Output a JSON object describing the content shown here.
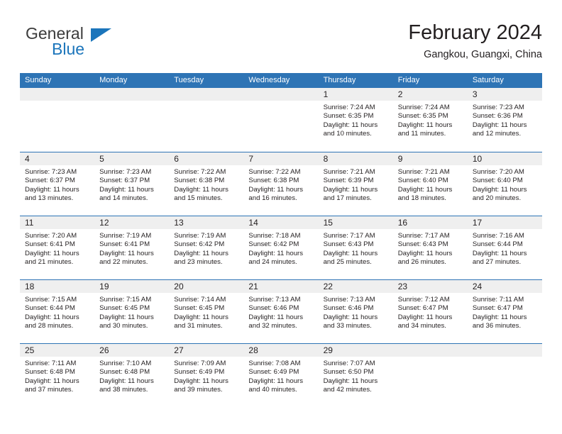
{
  "brand": {
    "line1": "General",
    "line2": "Blue",
    "logo_icon": "blue-triangle-icon",
    "color_text": "#3c3c3c",
    "color_accent": "#1b75bb"
  },
  "header": {
    "title": "February 2024",
    "subtitle": "Gangkou, Guangxi, China"
  },
  "theme": {
    "header_band": "#2e74b5",
    "day_band": "#efefef",
    "text": "#231f20"
  },
  "weekdays": [
    "Sunday",
    "Monday",
    "Tuesday",
    "Wednesday",
    "Thursday",
    "Friday",
    "Saturday"
  ],
  "labels": {
    "sunrise_prefix": "Sunrise:",
    "sunset_prefix": "Sunset:",
    "daylight_prefix": "Daylight:"
  },
  "weeks": [
    [
      {
        "day": "",
        "sunrise": "",
        "sunset": "",
        "daylight_line1": "",
        "daylight_line2": "",
        "empty": true
      },
      {
        "day": "",
        "sunrise": "",
        "sunset": "",
        "daylight_line1": "",
        "daylight_line2": "",
        "empty": true
      },
      {
        "day": "",
        "sunrise": "",
        "sunset": "",
        "daylight_line1": "",
        "daylight_line2": "",
        "empty": true
      },
      {
        "day": "",
        "sunrise": "",
        "sunset": "",
        "daylight_line1": "",
        "daylight_line2": "",
        "empty": true
      },
      {
        "day": "1",
        "sunrise": "Sunrise: 7:24 AM",
        "sunset": "Sunset: 6:35 PM",
        "daylight_line1": "Daylight: 11 hours",
        "daylight_line2": "and 10 minutes.",
        "empty": false
      },
      {
        "day": "2",
        "sunrise": "Sunrise: 7:24 AM",
        "sunset": "Sunset: 6:35 PM",
        "daylight_line1": "Daylight: 11 hours",
        "daylight_line2": "and 11 minutes.",
        "empty": false
      },
      {
        "day": "3",
        "sunrise": "Sunrise: 7:23 AM",
        "sunset": "Sunset: 6:36 PM",
        "daylight_line1": "Daylight: 11 hours",
        "daylight_line2": "and 12 minutes.",
        "empty": false
      }
    ],
    [
      {
        "day": "4",
        "sunrise": "Sunrise: 7:23 AM",
        "sunset": "Sunset: 6:37 PM",
        "daylight_line1": "Daylight: 11 hours",
        "daylight_line2": "and 13 minutes.",
        "empty": false
      },
      {
        "day": "5",
        "sunrise": "Sunrise: 7:23 AM",
        "sunset": "Sunset: 6:37 PM",
        "daylight_line1": "Daylight: 11 hours",
        "daylight_line2": "and 14 minutes.",
        "empty": false
      },
      {
        "day": "6",
        "sunrise": "Sunrise: 7:22 AM",
        "sunset": "Sunset: 6:38 PM",
        "daylight_line1": "Daylight: 11 hours",
        "daylight_line2": "and 15 minutes.",
        "empty": false
      },
      {
        "day": "7",
        "sunrise": "Sunrise: 7:22 AM",
        "sunset": "Sunset: 6:38 PM",
        "daylight_line1": "Daylight: 11 hours",
        "daylight_line2": "and 16 minutes.",
        "empty": false
      },
      {
        "day": "8",
        "sunrise": "Sunrise: 7:21 AM",
        "sunset": "Sunset: 6:39 PM",
        "daylight_line1": "Daylight: 11 hours",
        "daylight_line2": "and 17 minutes.",
        "empty": false
      },
      {
        "day": "9",
        "sunrise": "Sunrise: 7:21 AM",
        "sunset": "Sunset: 6:40 PM",
        "daylight_line1": "Daylight: 11 hours",
        "daylight_line2": "and 18 minutes.",
        "empty": false
      },
      {
        "day": "10",
        "sunrise": "Sunrise: 7:20 AM",
        "sunset": "Sunset: 6:40 PM",
        "daylight_line1": "Daylight: 11 hours",
        "daylight_line2": "and 20 minutes.",
        "empty": false
      }
    ],
    [
      {
        "day": "11",
        "sunrise": "Sunrise: 7:20 AM",
        "sunset": "Sunset: 6:41 PM",
        "daylight_line1": "Daylight: 11 hours",
        "daylight_line2": "and 21 minutes.",
        "empty": false
      },
      {
        "day": "12",
        "sunrise": "Sunrise: 7:19 AM",
        "sunset": "Sunset: 6:41 PM",
        "daylight_line1": "Daylight: 11 hours",
        "daylight_line2": "and 22 minutes.",
        "empty": false
      },
      {
        "day": "13",
        "sunrise": "Sunrise: 7:19 AM",
        "sunset": "Sunset: 6:42 PM",
        "daylight_line1": "Daylight: 11 hours",
        "daylight_line2": "and 23 minutes.",
        "empty": false
      },
      {
        "day": "14",
        "sunrise": "Sunrise: 7:18 AM",
        "sunset": "Sunset: 6:42 PM",
        "daylight_line1": "Daylight: 11 hours",
        "daylight_line2": "and 24 minutes.",
        "empty": false
      },
      {
        "day": "15",
        "sunrise": "Sunrise: 7:17 AM",
        "sunset": "Sunset: 6:43 PM",
        "daylight_line1": "Daylight: 11 hours",
        "daylight_line2": "and 25 minutes.",
        "empty": false
      },
      {
        "day": "16",
        "sunrise": "Sunrise: 7:17 AM",
        "sunset": "Sunset: 6:43 PM",
        "daylight_line1": "Daylight: 11 hours",
        "daylight_line2": "and 26 minutes.",
        "empty": false
      },
      {
        "day": "17",
        "sunrise": "Sunrise: 7:16 AM",
        "sunset": "Sunset: 6:44 PM",
        "daylight_line1": "Daylight: 11 hours",
        "daylight_line2": "and 27 minutes.",
        "empty": false
      }
    ],
    [
      {
        "day": "18",
        "sunrise": "Sunrise: 7:15 AM",
        "sunset": "Sunset: 6:44 PM",
        "daylight_line1": "Daylight: 11 hours",
        "daylight_line2": "and 28 minutes.",
        "empty": false
      },
      {
        "day": "19",
        "sunrise": "Sunrise: 7:15 AM",
        "sunset": "Sunset: 6:45 PM",
        "daylight_line1": "Daylight: 11 hours",
        "daylight_line2": "and 30 minutes.",
        "empty": false
      },
      {
        "day": "20",
        "sunrise": "Sunrise: 7:14 AM",
        "sunset": "Sunset: 6:45 PM",
        "daylight_line1": "Daylight: 11 hours",
        "daylight_line2": "and 31 minutes.",
        "empty": false
      },
      {
        "day": "21",
        "sunrise": "Sunrise: 7:13 AM",
        "sunset": "Sunset: 6:46 PM",
        "daylight_line1": "Daylight: 11 hours",
        "daylight_line2": "and 32 minutes.",
        "empty": false
      },
      {
        "day": "22",
        "sunrise": "Sunrise: 7:13 AM",
        "sunset": "Sunset: 6:46 PM",
        "daylight_line1": "Daylight: 11 hours",
        "daylight_line2": "and 33 minutes.",
        "empty": false
      },
      {
        "day": "23",
        "sunrise": "Sunrise: 7:12 AM",
        "sunset": "Sunset: 6:47 PM",
        "daylight_line1": "Daylight: 11 hours",
        "daylight_line2": "and 34 minutes.",
        "empty": false
      },
      {
        "day": "24",
        "sunrise": "Sunrise: 7:11 AM",
        "sunset": "Sunset: 6:47 PM",
        "daylight_line1": "Daylight: 11 hours",
        "daylight_line2": "and 36 minutes.",
        "empty": false
      }
    ],
    [
      {
        "day": "25",
        "sunrise": "Sunrise: 7:11 AM",
        "sunset": "Sunset: 6:48 PM",
        "daylight_line1": "Daylight: 11 hours",
        "daylight_line2": "and 37 minutes.",
        "empty": false
      },
      {
        "day": "26",
        "sunrise": "Sunrise: 7:10 AM",
        "sunset": "Sunset: 6:48 PM",
        "daylight_line1": "Daylight: 11 hours",
        "daylight_line2": "and 38 minutes.",
        "empty": false
      },
      {
        "day": "27",
        "sunrise": "Sunrise: 7:09 AM",
        "sunset": "Sunset: 6:49 PM",
        "daylight_line1": "Daylight: 11 hours",
        "daylight_line2": "and 39 minutes.",
        "empty": false
      },
      {
        "day": "28",
        "sunrise": "Sunrise: 7:08 AM",
        "sunset": "Sunset: 6:49 PM",
        "daylight_line1": "Daylight: 11 hours",
        "daylight_line2": "and 40 minutes.",
        "empty": false
      },
      {
        "day": "29",
        "sunrise": "Sunrise: 7:07 AM",
        "sunset": "Sunset: 6:50 PM",
        "daylight_line1": "Daylight: 11 hours",
        "daylight_line2": "and 42 minutes.",
        "empty": false
      },
      {
        "day": "",
        "sunrise": "",
        "sunset": "",
        "daylight_line1": "",
        "daylight_line2": "",
        "empty": true
      },
      {
        "day": "",
        "sunrise": "",
        "sunset": "",
        "daylight_line1": "",
        "daylight_line2": "",
        "empty": true
      }
    ]
  ]
}
